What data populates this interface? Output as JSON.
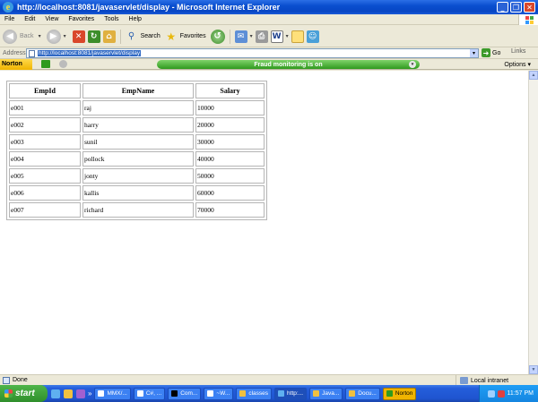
{
  "window": {
    "title": "http://localhost:8081/javaservlet/display - Microsoft Internet Explorer",
    "buttons": [
      "minimize-icon",
      "restore-icon",
      "close-icon"
    ]
  },
  "menu": [
    "File",
    "Edit",
    "View",
    "Favorites",
    "Tools",
    "Help"
  ],
  "toolbar": {
    "back_label": "Back",
    "search_label": "Search",
    "favorites_label": "Favorites"
  },
  "address": {
    "label": "Address",
    "url": "http://localhost:8081/javaservlet/display",
    "go_label": "Go",
    "links_label": "Links"
  },
  "norton": {
    "logo": "Norton",
    "fraud_text": "Fraud monitoring is on",
    "options_label": "Options"
  },
  "table": {
    "headers": [
      "EmpId",
      "EmpName",
      "Salary"
    ],
    "rows": [
      [
        "e001",
        "raj",
        "10000"
      ],
      [
        "e002",
        "harry",
        "20000"
      ],
      [
        "e003",
        "sunil",
        "30000"
      ],
      [
        "e004",
        "pollock",
        "40000"
      ],
      [
        "e005",
        "jonty",
        "50000"
      ],
      [
        "e006",
        "kallis",
        "60000"
      ],
      [
        "e007",
        "richard",
        "70000"
      ]
    ]
  },
  "status": {
    "text": "Done",
    "zone": "Local intranet"
  },
  "taskbar": {
    "start_label": "start",
    "tasks": [
      "MMX/...",
      "C#, ...",
      "Com...",
      "~W...",
      "classes",
      "http:...",
      "Java...",
      "Docu..."
    ],
    "active_task_index": 5,
    "norton_label": "Norton",
    "clock": "11:57 PM"
  },
  "colors": {
    "titlebar": "#0a4fcf",
    "fraud_bar": "#2f9a1e",
    "taskbar": "#245edb",
    "start": "#2f8f2b"
  }
}
